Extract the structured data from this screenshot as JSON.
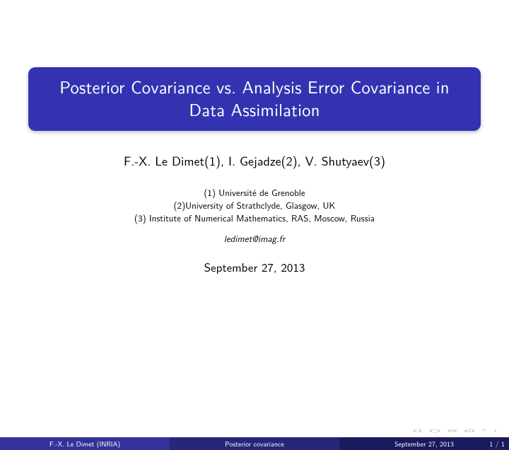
{
  "title": {
    "line1": "Posterior Covariance vs. Analysis Error Covariance in",
    "line2": "Data Assimilation"
  },
  "authors": "F.-X. Le Dimet(1), I. Gejadze(2), V. Shutyaev(3)",
  "affiliations": {
    "a1": "(1) Université de Grenoble",
    "a2": "(2)University of Strathclyde, Glasgow, UK",
    "a3": "(3) Institute of Numerical Mathematics, RAS, Moscow, Russia"
  },
  "email": "ledimet@imag.fr",
  "date": "September 27, 2013",
  "nav": {
    "first": "◂ □ ▸",
    "prev": "◂ 🗗 ▸",
    "section": "◂ ≡ ▸",
    "subsection": "◂ ≡ ▸",
    "back": "↶",
    "search": "⊘"
  },
  "footer": {
    "author": "F.-X. Le Dimet (INRIA)",
    "short_title": "Posterior covariance",
    "date": "September 27, 2013",
    "page": "1 / 1"
  }
}
